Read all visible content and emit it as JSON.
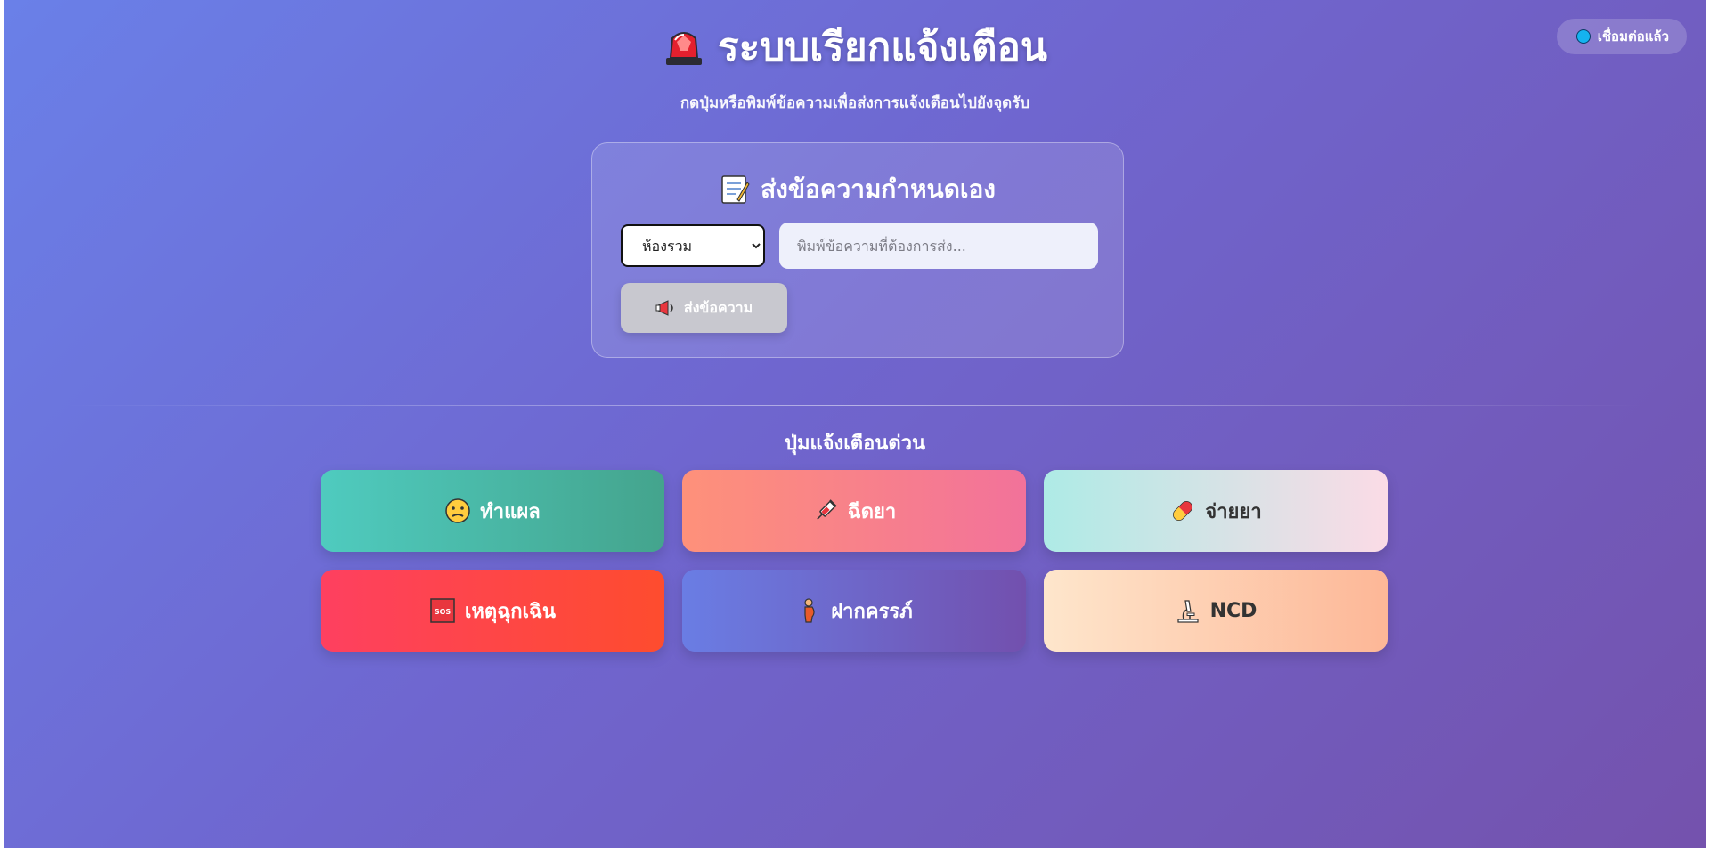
{
  "status": {
    "label": "เชื่อมต่อแล้ว",
    "dot_color": "#15b3f0"
  },
  "header": {
    "title": "ระบบเรียกแจ้งเตือน",
    "subtitle": "กดปุ่มหรือพิมพ์ข้อความเพื่อส่งการแจ้งเตือนไปยังจุดรับ"
  },
  "custom_message": {
    "title": "ส่งข้อความกำหนดเอง",
    "room_select": {
      "selected": "ห้องรวม",
      "options": [
        "ห้องรวม"
      ]
    },
    "input": {
      "value": "",
      "placeholder": "พิมพ์ข้อความที่ต้องการส่ง..."
    },
    "send_label": "ส่งข้อความ"
  },
  "quick_alerts": {
    "title": "ปุ่มแจ้งเตือนด่วน",
    "buttons": [
      {
        "label": "ทำแผล",
        "icon": "worried-face-icon"
      },
      {
        "label": "ฉีดยา",
        "icon": "syringe-icon"
      },
      {
        "label": "จ่ายยา",
        "icon": "pill-icon"
      },
      {
        "label": "เหตุฉุกเฉิน",
        "icon": "sos-icon"
      },
      {
        "label": "ฝากครรภ์",
        "icon": "pregnant-woman-icon"
      },
      {
        "label": "NCD",
        "icon": "microscope-icon"
      }
    ]
  },
  "colors": {
    "background_start": "#6a80e8",
    "background_end": "#7452ad",
    "emergency": "#fe4060",
    "connected": "#15b3f0"
  }
}
